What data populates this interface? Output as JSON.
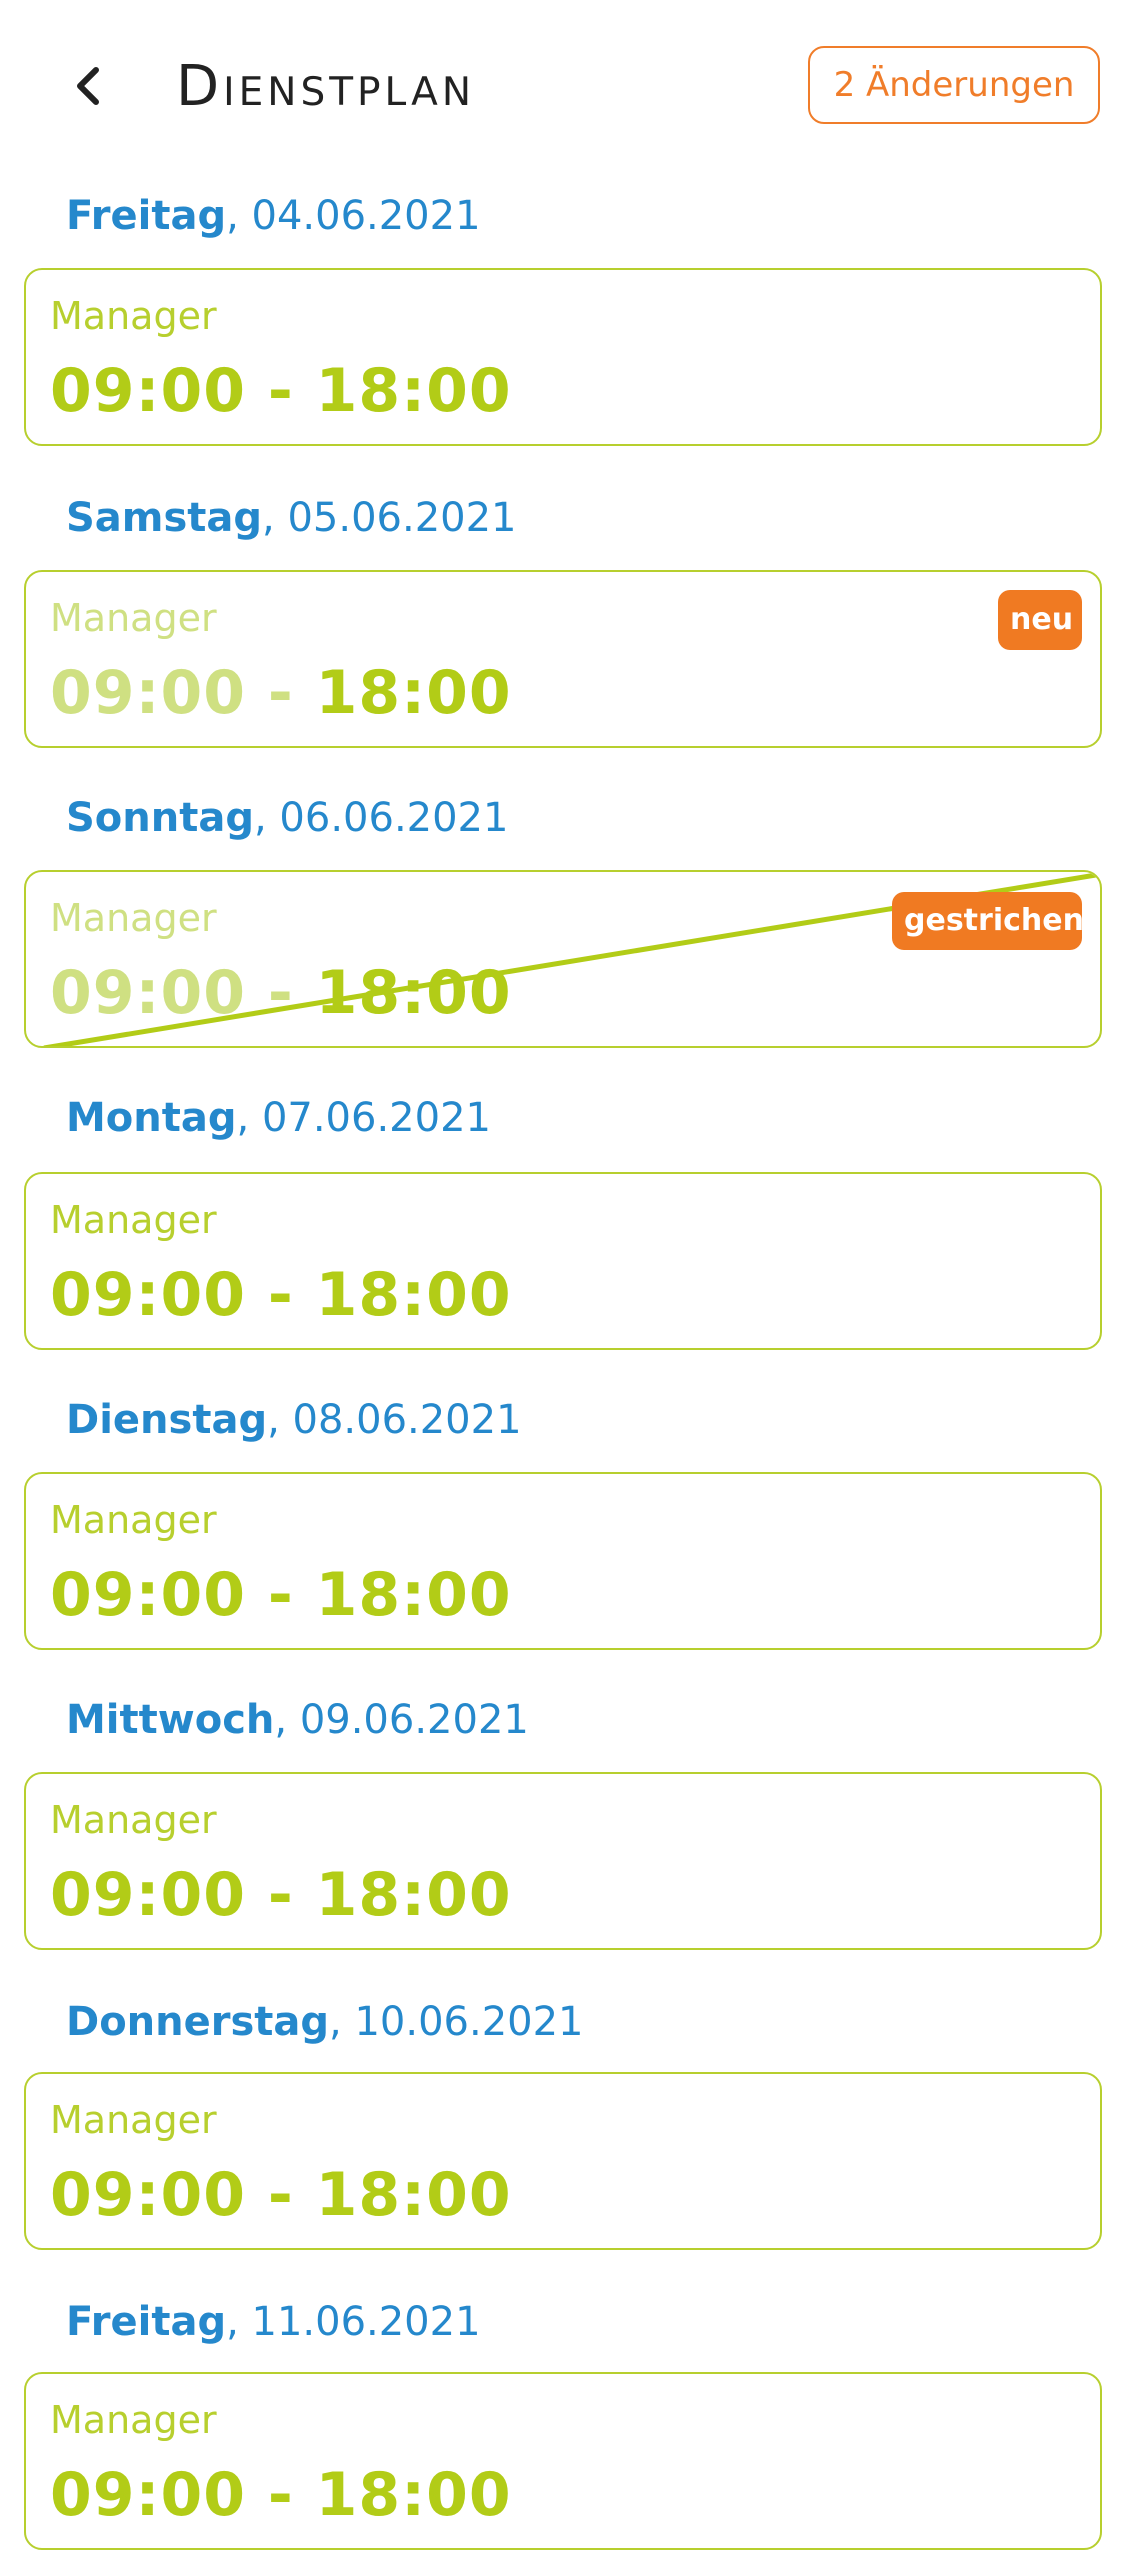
{
  "header": {
    "title": "Dienstplan",
    "changes_button_label": "2 Änderungen"
  },
  "colors": {
    "heading_blue": "#2588cc",
    "shift_green": "#b2cc17",
    "accent_orange": "#f07d2a"
  },
  "days": [
    {
      "name": "Freitag",
      "date": ", 04.06.2021",
      "role": "Manager",
      "time_start": "09:00 - ",
      "time_end": "18:00"
    },
    {
      "name": "Samstag",
      "date": ", 05.06.2021",
      "role": "Manager",
      "time_start": "09:00 - ",
      "time_end": "18:00",
      "badge": "neu"
    },
    {
      "name": "Sonntag",
      "date": ", 06.06.2021",
      "role": "Manager",
      "time_start": "09:00 - ",
      "time_end": "18:00",
      "badge": "gestrichen"
    },
    {
      "name": "Montag",
      "date": ", 07.06.2021",
      "role": "Manager",
      "time_start": "09:00 - ",
      "time_end": "18:00"
    },
    {
      "name": "Dienstag",
      "date": ", 08.06.2021",
      "role": "Manager",
      "time_start": "09:00 - ",
      "time_end": "18:00"
    },
    {
      "name": "Mittwoch",
      "date": ", 09.06.2021",
      "role": "Manager",
      "time_start": "09:00 - ",
      "time_end": "18:00"
    },
    {
      "name": "Donnerstag",
      "date": ", 10.06.2021",
      "role": "Manager",
      "time_start": "09:00 - ",
      "time_end": "18:00"
    },
    {
      "name": "Freitag",
      "date": ", 11.06.2021",
      "role": "Manager",
      "time_start": "09:00 - ",
      "time_end": "18:00"
    }
  ]
}
